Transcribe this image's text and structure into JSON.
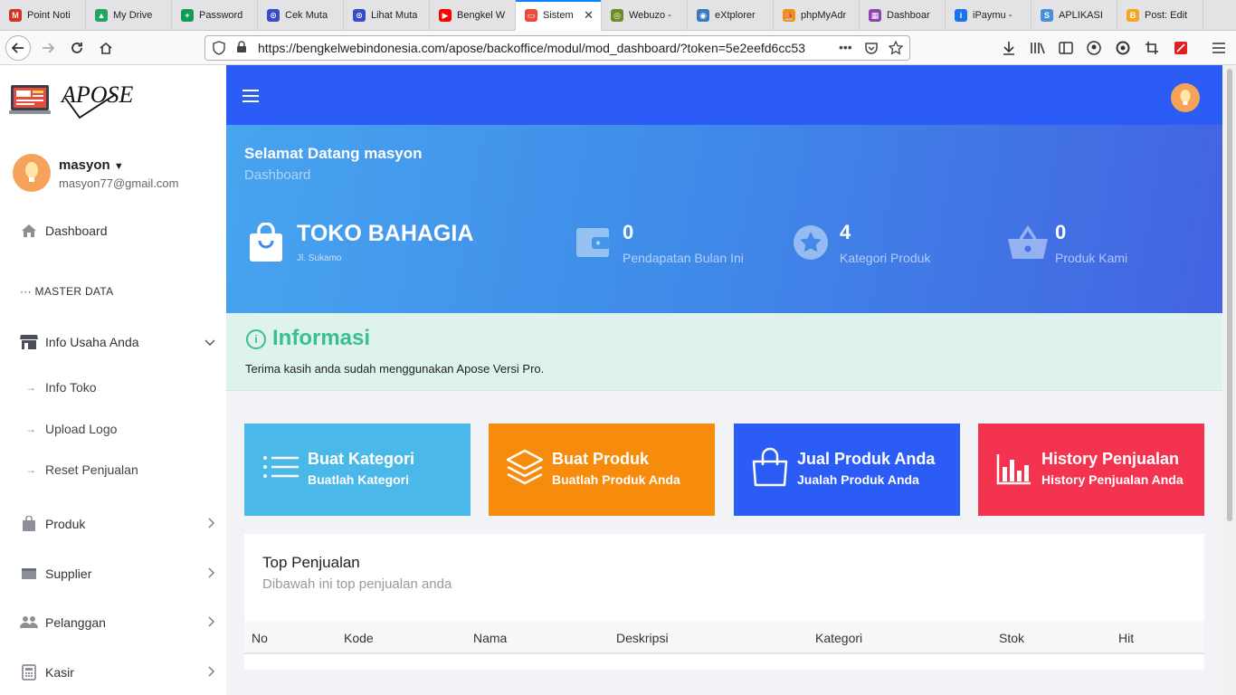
{
  "browser": {
    "tabs": [
      {
        "label": "Point Noti",
        "color": "#d93025",
        "glyph": "M"
      },
      {
        "label": "My Drive",
        "color": "#1fa463",
        "glyph": "▲"
      },
      {
        "label": "Password",
        "color": "#0f9d58",
        "glyph": "+"
      },
      {
        "label": "Cek Muta",
        "color": "#3b4cca",
        "glyph": "⊙"
      },
      {
        "label": "Lihat Muta",
        "color": "#3b4cca",
        "glyph": "⊙"
      },
      {
        "label": "Bengkel W",
        "color": "#ff0000",
        "glyph": "▶"
      },
      {
        "label": "Sistem",
        "color": "#e84c3d",
        "glyph": "▭"
      },
      {
        "label": "Webuzo -",
        "color": "#6b8e23",
        "glyph": "◎"
      },
      {
        "label": "eXtplorer",
        "color": "#3a7ab8",
        "glyph": "◉"
      },
      {
        "label": "phpMyAdr",
        "color": "#f29111",
        "glyph": "⛵"
      },
      {
        "label": "Dashboar",
        "color": "#8e44ad",
        "glyph": "▦"
      },
      {
        "label": "iPaymu -",
        "color": "#1a73e8",
        "glyph": "i"
      },
      {
        "label": "APLIKASI",
        "color": "#4a90d9",
        "glyph": "S"
      },
      {
        "label": "Post: Edit",
        "color": "#f5a623",
        "glyph": "B"
      }
    ],
    "active_tab_index": 6,
    "url": "https://bengkelwebindonesia.com/apose/backoffice/modul/mod_dashboard/?token=5e2eefd6cc53",
    "url_menu": "•••"
  },
  "app": {
    "logo_text": "APOSE"
  },
  "user": {
    "name": "masyon",
    "email": "masyon77@gmail.com"
  },
  "sidebar": {
    "dashboard": "Dashboard",
    "section": "MASTER DATA",
    "info_usaha": "Info Usaha Anda",
    "sub_items": [
      "Info Toko",
      "Upload Logo",
      "Reset Penjualan"
    ],
    "items": [
      "Produk",
      "Supplier",
      "Pelanggan",
      "Kasir"
    ]
  },
  "hero": {
    "welcome": "Selamat Datang masyon",
    "breadcrumb": "Dashboard",
    "store_name": "TOKO BAHAGIA",
    "store_address": "Jl. Sukamo",
    "stats": [
      {
        "value": "0",
        "label": "Pendapatan Bulan Ini",
        "icon": "wallet-icon"
      },
      {
        "value": "4",
        "label": "Kategori Produk",
        "icon": "star-icon"
      },
      {
        "value": "0",
        "label": "Produk Kami",
        "icon": "basket-icon"
      }
    ]
  },
  "info": {
    "title": "Informasi",
    "text": "Terima kasih anda sudah menggunakan Apose Versi Pro."
  },
  "cards": [
    {
      "title": "Buat Kategori",
      "subtitle": "Buatlah Kategori",
      "color": "#4ab9ea",
      "icon": "list-icon"
    },
    {
      "title": "Buat Produk",
      "subtitle": "Buatlah Produk Anda",
      "color": "#f78b0c",
      "icon": "layers-icon"
    },
    {
      "title": "Jual Produk Anda",
      "subtitle": "Jualah Produk Anda",
      "color": "#2b5cf6",
      "icon": "shopping-bag-icon"
    },
    {
      "title": "History Penjualan",
      "subtitle": "History Penjualan Anda",
      "color": "#f3334f",
      "icon": "bar-chart-icon"
    }
  ],
  "top_sales": {
    "title": "Top Penjualan",
    "subtitle": "Dibawah ini top penjualan anda",
    "columns": [
      "No",
      "Kode",
      "Nama",
      "Deskripsi",
      "Kategori",
      "Stok",
      "Hit"
    ]
  },
  "colors": {
    "topbar": "#2b5cf6",
    "info_accent": "#3bbf8c",
    "avatar": "#f5a35b"
  }
}
